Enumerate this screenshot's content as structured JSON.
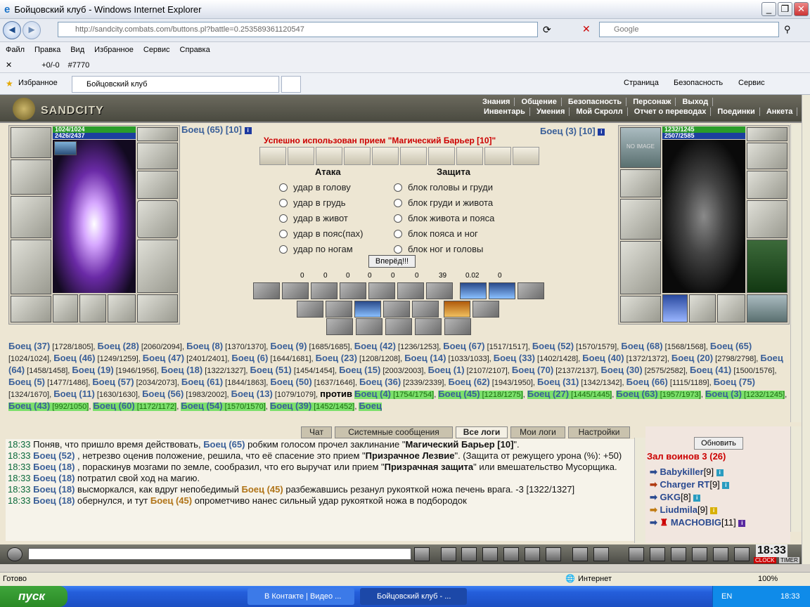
{
  "window": {
    "title": "Бойцовский клуб - Windows Internet Explorer"
  },
  "address": {
    "url": "http://sandcity.combats.com/buttons.pl?battle=0.253589361120547",
    "search_placeholder": "Google"
  },
  "menu": [
    "Файл",
    "Правка",
    "Вид",
    "Избранное",
    "Сервис",
    "Справка"
  ],
  "toolbar2": {
    "counter": "+0/-0",
    "id": "#7770"
  },
  "favbar": {
    "favorites": "Избранное",
    "tab": "Бойцовский клуб",
    "page": "Страница",
    "security": "Безопасность",
    "service": "Сервис"
  },
  "game": {
    "logo": "SANDCITY",
    "menu_top": [
      "Знания",
      "Общение",
      "Безопасность",
      "Персонаж",
      "Выход"
    ],
    "menu_bottom": [
      "Инвентарь",
      "Умения",
      "Мой Скролл",
      "Отчет о переводах",
      "Поединки",
      "Анкета"
    ],
    "left": {
      "name": "Боец (65) [10]",
      "hp": "1024/1024",
      "mana": "2426/2437"
    },
    "right": {
      "name": "Боец (3) [10]",
      "hp": "1232/1245",
      "mana": "2507/2585",
      "noimage": "NO IMAGE"
    },
    "message": "Успешно использован прием \"Магический Барьер [10]\"",
    "attack_title": "Атака",
    "defense_title": "Защита",
    "attacks": [
      "удар в голову",
      "удар в грудь",
      "удар в живот",
      "удар в пояс(пах)",
      "удар по ногам"
    ],
    "defenses": [
      "блок головы и груди",
      "блок груди и живота",
      "блок живота и пояса",
      "блок пояса и ног",
      "блок ног и головы"
    ],
    "go_button": "Вперёд!!!",
    "stats": [
      "0",
      "0",
      "0",
      "0",
      "0",
      "0",
      "39",
      "0.02",
      "0"
    ]
  },
  "roster": {
    "left": [
      "Боец (37) [1728/1805]",
      "Боец (28) [2060/2094]",
      "Боец (8) [1370/1370]",
      "Боец (9) [1685/1685]",
      "Боец (42) [1236/1253]",
      "Боец (67) [1517/1517]",
      "Боец (52) [1570/1579]",
      "Боец (68) [1568/1568]",
      "Боец (65) [1024/1024]",
      "Боец (46) [1249/1259]",
      "Боец (47) [2401/2401]",
      "Боец (6) [1644/1681]",
      "Боец (23) [1208/1208]",
      "Боец (14) [1033/1033]",
      "Боец (33) [1402/1428]",
      "Боец (40) [1372/1372]",
      "Боец (20) [2798/2798]",
      "Боец (64) [1458/1458]",
      "Боец (19) [1946/1956]",
      "Боец (18) [1322/1327]",
      "Боец (51) [1454/1454]",
      "Боец (15) [2003/2003]",
      "Боец (1) [2107/2107]",
      "Боец (70) [2137/2137]",
      "Боец (30) [2575/2582]",
      "Боец (41) [1500/1576]",
      "Боец (5) [1477/1486]",
      "Боец (57) [2034/2073]",
      "Боец (61) [1844/1863]",
      "Боец (50) [1637/1646]",
      "Боец (36) [2339/2339]",
      "Боец (62) [1943/1950]",
      "Боец (31) [1342/1342]",
      "Боец (66) [1115/1189]",
      "Боец (75) [1324/1670]",
      "Боец (11) [1630/1630]",
      "Боец (56) [1983/2002]",
      "Боец (13) [1079/1079]"
    ],
    "vs": "против",
    "right": [
      "Боец (4) [1754/1754]",
      "Боец (45) [1218/1275]",
      "Боец (27) [1445/1445]",
      "Боец (63) [1957/1973]",
      "Боец (3) [1232/1245]",
      "Боец (43) [992/1050]",
      "Боец (60) [1172/1172]",
      "Боец (54) [1570/1570]",
      "Боец (39) [1452/1452]",
      "Боец"
    ]
  },
  "chat": {
    "tabs": [
      "Чат",
      "Системные сообщения",
      "Все логи",
      "Мои логи",
      "Настройки"
    ],
    "lines": [
      {
        "time": "18:33",
        "a": "Поняв, что пришло время действовать,",
        "f": "Боец (65)",
        "b": "робким голосом прочел заклинание \"",
        "s": "Магический Барьер [10]",
        "c": "\"."
      },
      {
        "time": "18:33",
        "a": "",
        "f": "Боец (52)",
        "b": ", нетрезво оценив положение, решила, что её спасение это прием \"",
        "s": "Призрачное Лезвие",
        "c": "\". (Защита от режущего урона (%): +50)"
      },
      {
        "time": "18:33",
        "a": "",
        "f": "Боец (18)",
        "b": ", пораскинув мозгами по земле, сообразил, что его выручат или прием \"",
        "s": "Призрачная защита",
        "c": "\" или вмешательство Мусорщика."
      },
      {
        "time": "18:33",
        "a": "",
        "f": "Боец (18)",
        "b": "потратил свой ход на магию.",
        "s": "",
        "c": ""
      },
      {
        "time": "18:33",
        "a": "",
        "f": "Боец (18)",
        "b": "высморкался, как вдруг непобедимый",
        "s": "Боец (45)",
        "c": "разбежавшись резанул рукояткой ножа печень врага. -3 [1322/1327]"
      },
      {
        "time": "18:33",
        "a": "",
        "f": "Боец (18)",
        "b": "обернулся, и тут",
        "s": "Боец (45)",
        "c": "опрометчиво нанес сильный удар рукояткой ножа в подбородок"
      }
    ],
    "refresh": "Обновить",
    "room": "Зал воинов 3 (26)",
    "users": [
      {
        "name": "Babykiller",
        "lv": "[9]"
      },
      {
        "name": "Charger RT",
        "lv": "[9]"
      },
      {
        "name": "GKG",
        "lv": "[8]"
      },
      {
        "name": "Liudmila",
        "lv": "[9]"
      },
      {
        "name": "MACHOBIG",
        "lv": "[11]"
      }
    ],
    "clock": "18:33",
    "clock_labels": [
      "CLOCK",
      "TIMER"
    ]
  },
  "status": {
    "left": "Готово",
    "zone": "Интернет",
    "zoom": "100%"
  },
  "taskbar": {
    "start": "пуск",
    "tasks": [
      "В Контакте | Видео ...",
      "Бойцовский клуб - ..."
    ],
    "lang": "EN",
    "time": "18:33"
  },
  "colors": {
    "fighter": "#3a5f98",
    "red": "#cc0000",
    "green_highlight": "#7ce06b"
  }
}
